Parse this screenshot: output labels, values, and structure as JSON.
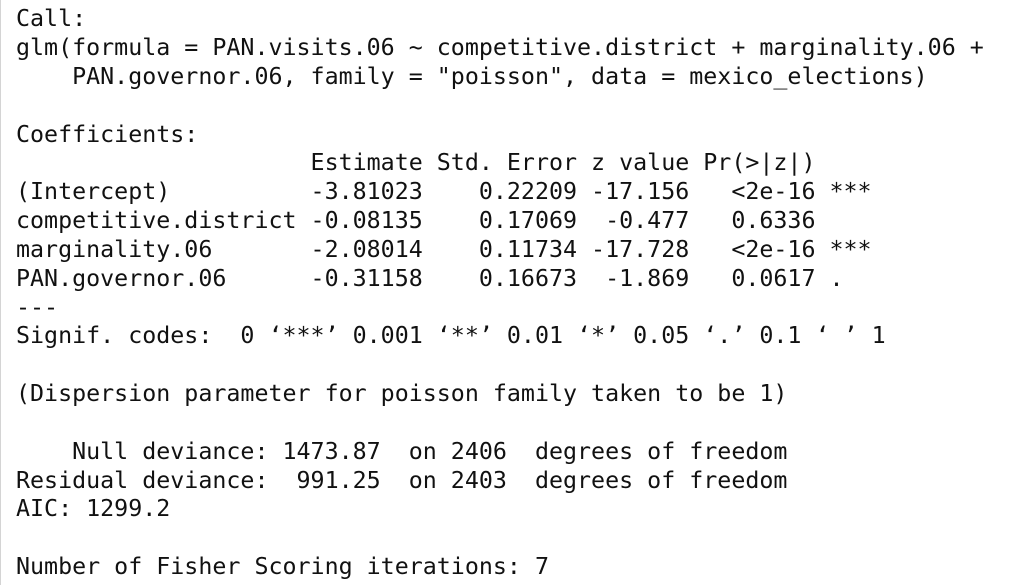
{
  "console": {
    "lines": [
      "Call:",
      "glm(formula = PAN.visits.06 ~ competitive.district + marginality.06 +",
      "    PAN.governor.06, family = \"poisson\", data = mexico_elections)",
      "",
      "Coefficients:",
      "                     Estimate Std. Error z value Pr(>|z|)    ",
      "(Intercept)          -3.81023    0.22209 -17.156   <2e-16 ***",
      "competitive.district -0.08135    0.17069  -0.477   0.6336    ",
      "marginality.06       -2.08014    0.11734 -17.728   <2e-16 ***",
      "PAN.governor.06      -0.31158    0.16673  -1.869   0.0617 .  ",
      "---",
      "Signif. codes:  0 ‘***’ 0.001 ‘**’ 0.01 ‘*’ 0.05 ‘.’ 0.1 ‘ ’ 1",
      "",
      "(Dispersion parameter for poisson family taken to be 1)",
      "",
      "    Null deviance: 1473.87  on 2406  degrees of freedom",
      "Residual deviance:  991.25  on 2403  degrees of freedom",
      "AIC: 1299.2",
      "",
      "Number of Fisher Scoring iterations: 7"
    ]
  }
}
